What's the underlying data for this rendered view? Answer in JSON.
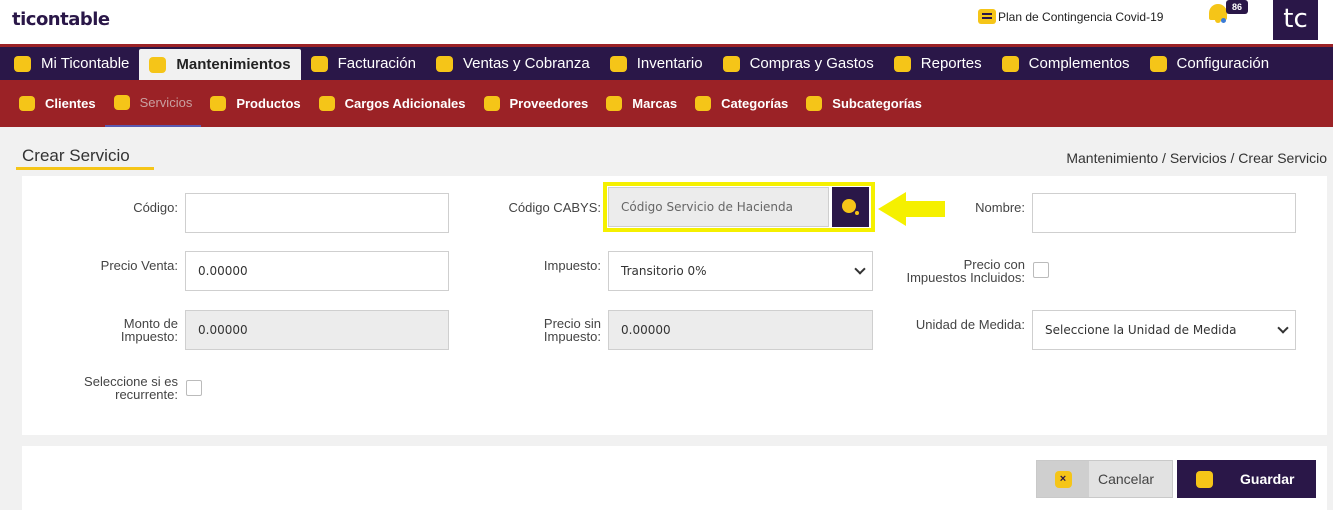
{
  "header": {
    "logo": "ticontable",
    "plan_label": "Plan de Contingencia Covid-19",
    "notifications_count": "86",
    "avatar_initials": "tc"
  },
  "main_nav": [
    {
      "label": "Mi Ticontable",
      "icon": "home-icon"
    },
    {
      "label": "Mantenimientos",
      "icon": "gear-icon",
      "active": true
    },
    {
      "label": "Facturación",
      "icon": "invoice-icon"
    },
    {
      "label": "Ventas y Cobranza",
      "icon": "truck-icon"
    },
    {
      "label": "Inventario",
      "icon": "boxes-icon"
    },
    {
      "label": "Compras y Gastos",
      "icon": "money-bag-icon"
    },
    {
      "label": "Reportes",
      "icon": "presentation-icon"
    },
    {
      "label": "Complementos",
      "icon": "plus-icon"
    },
    {
      "label": "Configuración",
      "icon": "cog-icon"
    }
  ],
  "sub_nav": [
    {
      "label": "Clientes",
      "icon": "client-icon"
    },
    {
      "label": "Servicios",
      "icon": "service-icon",
      "active": true
    },
    {
      "label": "Productos",
      "icon": "layers-icon"
    },
    {
      "label": "Cargos Adicionales",
      "icon": "card-icon"
    },
    {
      "label": "Proveedores",
      "icon": "boxes-icon"
    },
    {
      "label": "Marcas",
      "icon": "flag-icon"
    },
    {
      "label": "Categorías",
      "icon": "category-icon"
    },
    {
      "label": "Subcategorías",
      "icon": "subcategory-icon"
    }
  ],
  "page": {
    "title": "Crear Servicio",
    "breadcrumb": "Mantenimiento / Servicios / Crear Servicio"
  },
  "form": {
    "codigo_label": "Código:",
    "codigo_value": "",
    "cabys_label": "Código CABYS:",
    "cabys_placeholder": "Código Servicio de Hacienda",
    "nombre_label": "Nombre:",
    "nombre_value": "",
    "precio_venta_label": "Precio Venta:",
    "precio_venta_value": "0.00000",
    "impuesto_label": "Impuesto:",
    "impuesto_value": "Transitorio 0%",
    "precio_con_imp_label_1": "Precio con",
    "precio_con_imp_label_2": "Impuestos Incluidos:",
    "monto_label_1": "Monto de",
    "monto_label_2": "Impuesto:",
    "monto_value": "0.00000",
    "precio_sin_label_1": "Precio sin",
    "precio_sin_label_2": "Impuesto:",
    "precio_sin_value": "0.00000",
    "unidad_label": "Unidad de Medida:",
    "unidad_value": "Seleccione la Unidad de Medida",
    "recurrente_label_1": "Seleccione si es",
    "recurrente_label_2": "recurrente:"
  },
  "actions": {
    "cancel_label": "Cancelar",
    "save_label": "Guardar"
  },
  "colors": {
    "primary": "#2a1748",
    "accent": "#f5c518",
    "subnav": "#9b2226",
    "highlight": "#f5f000"
  }
}
